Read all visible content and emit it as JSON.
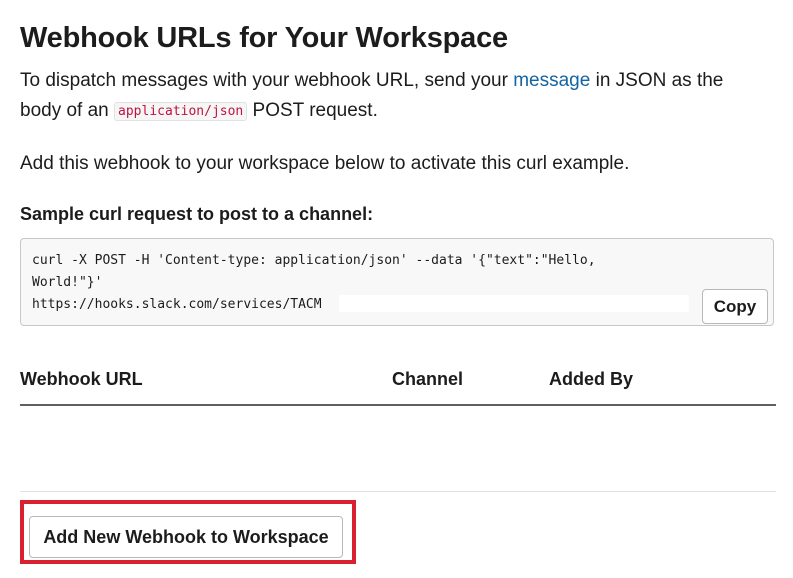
{
  "page": {
    "title": "Webhook URLs for Your Workspace"
  },
  "intro": {
    "text_before_link": "To dispatch messages with your webhook URL, send your ",
    "link_text": "message",
    "text_after_link": " in JSON as the body of an ",
    "inline_code": "application/json",
    "text_end": " POST request."
  },
  "activate_note": "Add this webhook to your workspace below to activate this curl example.",
  "sample": {
    "heading": "Sample curl request to post to a channel:",
    "code": "curl -X POST -H 'Content-type: application/json' --data '{\"text\":\"Hello, World!\"}'\nhttps://hooks.slack.com/services/TACM",
    "copy_label": "Copy"
  },
  "table": {
    "columns": [
      "Webhook URL",
      "Channel",
      "Added By"
    ],
    "rows": []
  },
  "actions": {
    "add_webhook_label": "Add New Webhook to Workspace"
  },
  "colors": {
    "link": "#1264a3",
    "inline_code": "#c01343",
    "highlight_border": "#d92030",
    "text": "#1d1c1d"
  }
}
